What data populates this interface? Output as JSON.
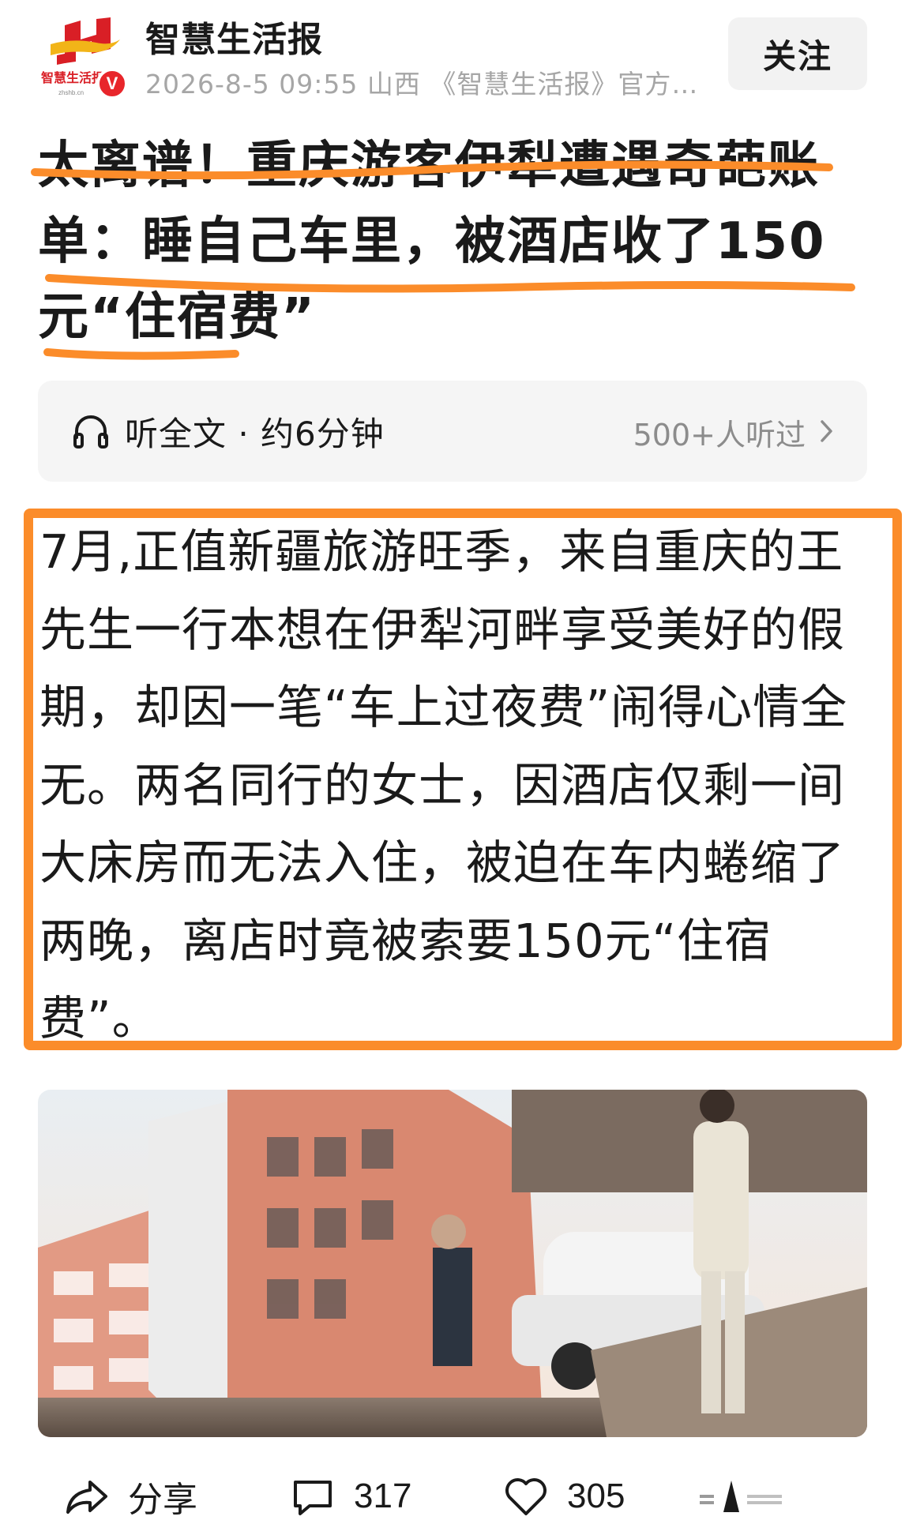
{
  "author": {
    "name": "智慧生活报",
    "logo_text": "智慧生活报",
    "verified_badge": "V",
    "meta": "2026-8-5  09:55  山西  《智慧生活报》官方…",
    "follow_label": "关注"
  },
  "article": {
    "title": "太离谱！重庆游客伊犁遭遇奇葩账单：睡自己车里，被酒店收了150元“住宿费”",
    "listen": {
      "label": "听全文 · 约6分钟",
      "count": "500+人听过"
    },
    "body": "7月,正值新疆旅游旺季，来自重庆的王先生一行本想在伊犁河畔享受美好的假期，却因一笔“车上过夜费”闹得心情全无。两名同行的女士，因酒店仅剩一间大床房而无法入住，被迫在车内蜷缩了两晚，离店时竟被索要150元“住宿费”。"
  },
  "actions": {
    "share_label": "分享",
    "comment_count": "317",
    "like_count": "305"
  },
  "colors": {
    "highlight": "#fb8c2a",
    "verified": "#e8262b",
    "logo_red": "#d91f26",
    "logo_gold": "#f2b418"
  },
  "icons": [
    "headphones-icon",
    "chevron-right-icon",
    "share-icon",
    "comment-icon",
    "heart-icon",
    "more-icon"
  ]
}
